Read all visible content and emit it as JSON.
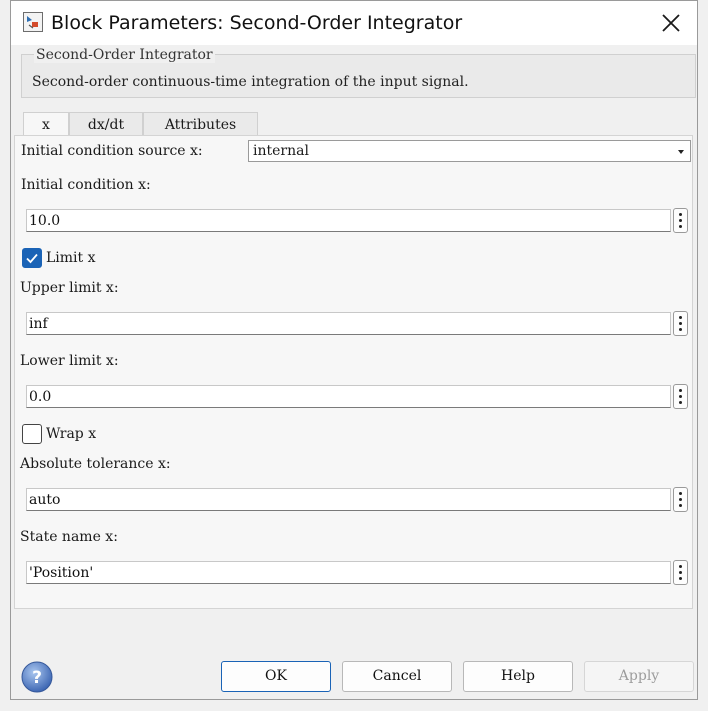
{
  "window": {
    "title": "Block Parameters: Second-Order Integrator",
    "icon": "simulink-block-icon"
  },
  "block": {
    "group_title": "Second-Order Integrator",
    "description": "Second-order continuous-time integration of the input signal."
  },
  "tabs": [
    {
      "label": "x",
      "active": true
    },
    {
      "label": "dx/dt",
      "active": false
    },
    {
      "label": "Attributes",
      "active": false
    }
  ],
  "params": {
    "ic_source_label": "Initial condition source x:",
    "ic_source_value": "internal",
    "ic_label": "Initial condition x:",
    "ic_value": "10.0",
    "limit_label": "Limit x",
    "limit_checked": true,
    "upper_label": "Upper limit x:",
    "upper_value": "inf",
    "lower_label": "Lower limit x:",
    "lower_value": "0.0",
    "wrap_label": "Wrap x",
    "wrap_checked": false,
    "abstol_label": "Absolute tolerance x:",
    "abstol_value": "auto",
    "state_label": "State name x:",
    "state_value": "'Position'"
  },
  "buttons": {
    "ok": "OK",
    "cancel": "Cancel",
    "help": "Help",
    "apply": "Apply"
  },
  "colors": {
    "accent": "#1a63b6",
    "disabled_text": "#9c9c9c"
  }
}
